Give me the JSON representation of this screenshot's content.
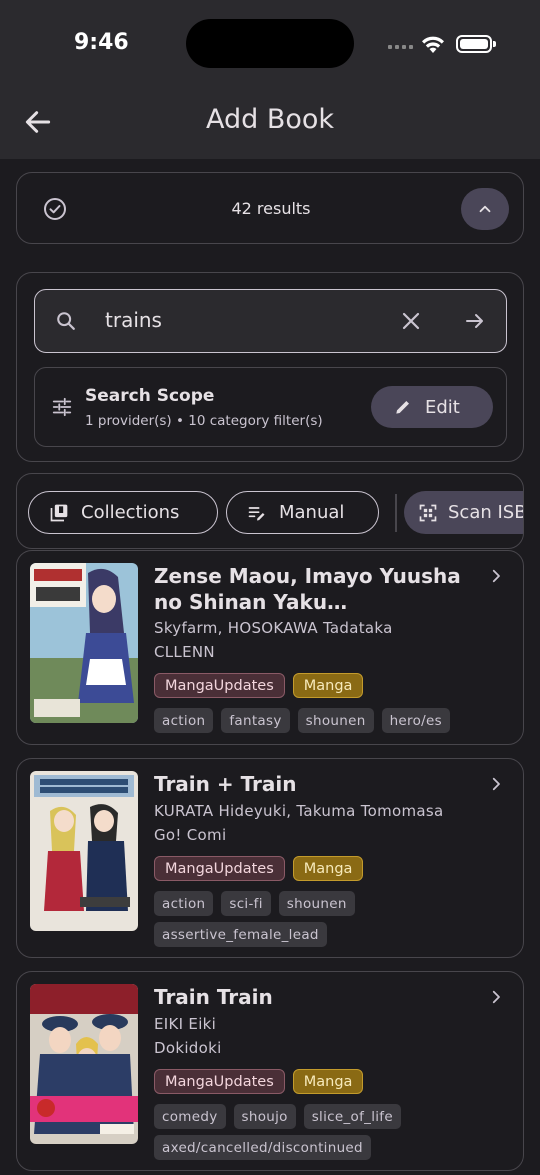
{
  "status": {
    "time": "9:46"
  },
  "app_bar": {
    "title": "Add Book"
  },
  "results": {
    "count_label": "42 results"
  },
  "search": {
    "value": "trains",
    "scope_title": "Search Scope",
    "scope_summary": "1 provider(s) • 10 category filter(s)",
    "edit_label": "Edit"
  },
  "actions": {
    "collections_label": "Collections",
    "manual_label": "Manual",
    "scan_label": "Scan ISBN"
  },
  "books": [
    {
      "title": "Zense Maou, Imayo Yuusha no Shinan Yaku ~Umarekawatta Maou~",
      "authors": "Skyfarm, HOSOKAWA Tadataka",
      "publisher": "CLLENN",
      "source": "MangaUpdates",
      "type": "Manga",
      "tags": [
        "action",
        "fantasy",
        "shounen",
        "hero/es"
      ]
    },
    {
      "title": "Train + Train",
      "authors": "KURATA Hideyuki, Takuma Tomomasa",
      "publisher": "Go! Comi",
      "source": "MangaUpdates",
      "type": "Manga",
      "tags": [
        "action",
        "sci-fi",
        "shounen",
        "assertive_female_lead"
      ]
    },
    {
      "title": "Train Train",
      "authors": "EIKI Eiki",
      "publisher": "Dokidoki",
      "source": "MangaUpdates",
      "type": "Manga",
      "tags": [
        "comedy",
        "shoujo",
        "slice_of_life",
        "axed/cancelled/discontinued"
      ]
    }
  ],
  "colors": {
    "background": "#1c1b1f",
    "surface": "#2b2a2e",
    "tonal_button": "#4a4658",
    "source_badge": "#4a2f37",
    "type_badge": "#8a6a14"
  }
}
